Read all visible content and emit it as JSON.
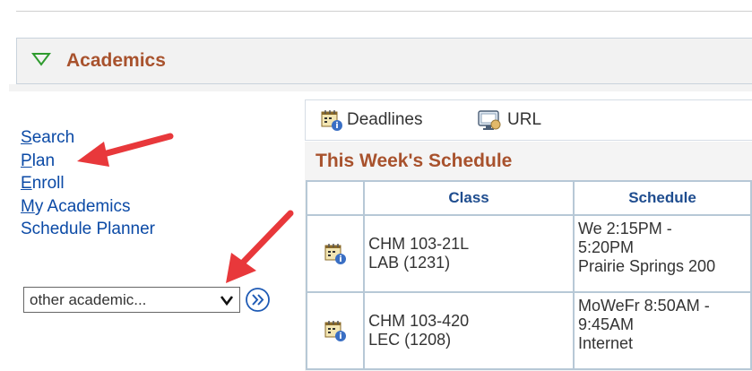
{
  "section": {
    "title": "Academics"
  },
  "left_links": [
    {
      "accesskey": "S",
      "rest": "earch"
    },
    {
      "accesskey": "P",
      "rest": "lan"
    },
    {
      "accesskey": "E",
      "rest": "nroll"
    },
    {
      "accesskey": "M",
      "rest": "y Academics"
    },
    {
      "accesskey": "",
      "rest": "Schedule Planner"
    }
  ],
  "academic_select": {
    "value": "other academic..."
  },
  "toolbar": {
    "deadlines_label": "Deadlines",
    "url_label": "URL"
  },
  "schedule": {
    "title": "This Week's Schedule",
    "headers": {
      "class": "Class",
      "schedule": "Schedule"
    },
    "rows": [
      {
        "class_line1": "CHM 103-21L",
        "class_line2": "LAB (1231)",
        "sched_line1": "We 2:15PM -",
        "sched_line2": "5:20PM",
        "sched_line3": "Prairie Springs 200"
      },
      {
        "class_line1": "CHM 103-420",
        "class_line2": "LEC (1208)",
        "sched_line1": "MoWeFr 8:50AM -",
        "sched_line2": "9:45AM",
        "sched_line3": "Internet"
      }
    ]
  },
  "colors": {
    "section_title": "#a8522d",
    "link": "#0b4aa6",
    "header_text": "#1f4d8f",
    "annotation_arrow": "#e8383b",
    "table_border": "#b7c8d6"
  },
  "icons": {
    "collapse": "triangle-down-icon",
    "deadlines": "calendar-info-icon",
    "url": "url-monitor-icon",
    "go": "double-chevron-right-icon",
    "row": "calendar-info-icon"
  }
}
